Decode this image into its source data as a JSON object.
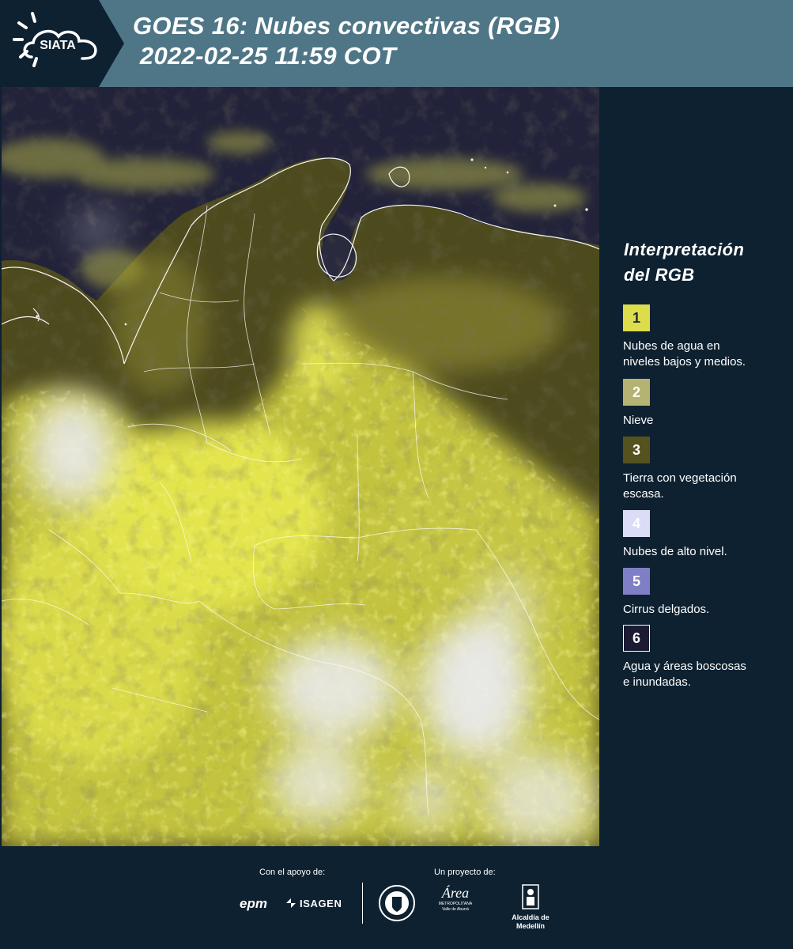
{
  "header": {
    "logo_text": "SIATA",
    "title_line1": "GOES 16: Nubes convectivas (RGB)",
    "title_line2": " 2022-02-25 11:59 COT"
  },
  "legend": {
    "title_line1": "Interpretación",
    "title_line2": "del RGB",
    "items": [
      {
        "number": "1",
        "label_line1": "Nubes de agua en",
        "label_line2": "niveles bajos y medios.",
        "color": "#dcdc4c",
        "text_color": "#1d2b33"
      },
      {
        "number": "2",
        "label_line1": "Nieve",
        "label_line2": "",
        "color": "#b5b371",
        "text_color": "#ffffff"
      },
      {
        "number": "3",
        "label_line1": "Tierra con vegetación",
        "label_line2": "escasa.",
        "color": "#55521f",
        "text_color": "#ffffff"
      },
      {
        "number": "4",
        "label_line1": "Nubes de alto nivel.",
        "label_line2": "",
        "color": "#dcdcf6",
        "text_color": "#ffffff"
      },
      {
        "number": "5",
        "label_line1": "Cirrus delgados.",
        "label_line2": "",
        "color": "#7f7fc5",
        "text_color": "#ffffff"
      },
      {
        "number": "6",
        "label_line1": "Agua y áreas boscosas",
        "label_line2": "e inundadas.",
        "color": "#1c1b34",
        "text_color": "#ffffff"
      }
    ]
  },
  "footer": {
    "support_caption": "Con el apoyo de:",
    "project_caption": "Un proyecto de:",
    "epm_logo": "epm",
    "isagen_logo": "ISAGEN",
    "area_logo": "Área",
    "area_sub1": "METROPOLITANA",
    "area_sub2": "Valle de Aburrá",
    "alcaldia_logo": "Alcaldía de Medellín"
  },
  "colors": {
    "header_bg": "#4f7687",
    "panel_bg": "#0e2130",
    "water": "#22223a",
    "land": "#4d4a1e",
    "low_cloud": "#e5e54a",
    "high_cloud": "#e4e4ef"
  }
}
